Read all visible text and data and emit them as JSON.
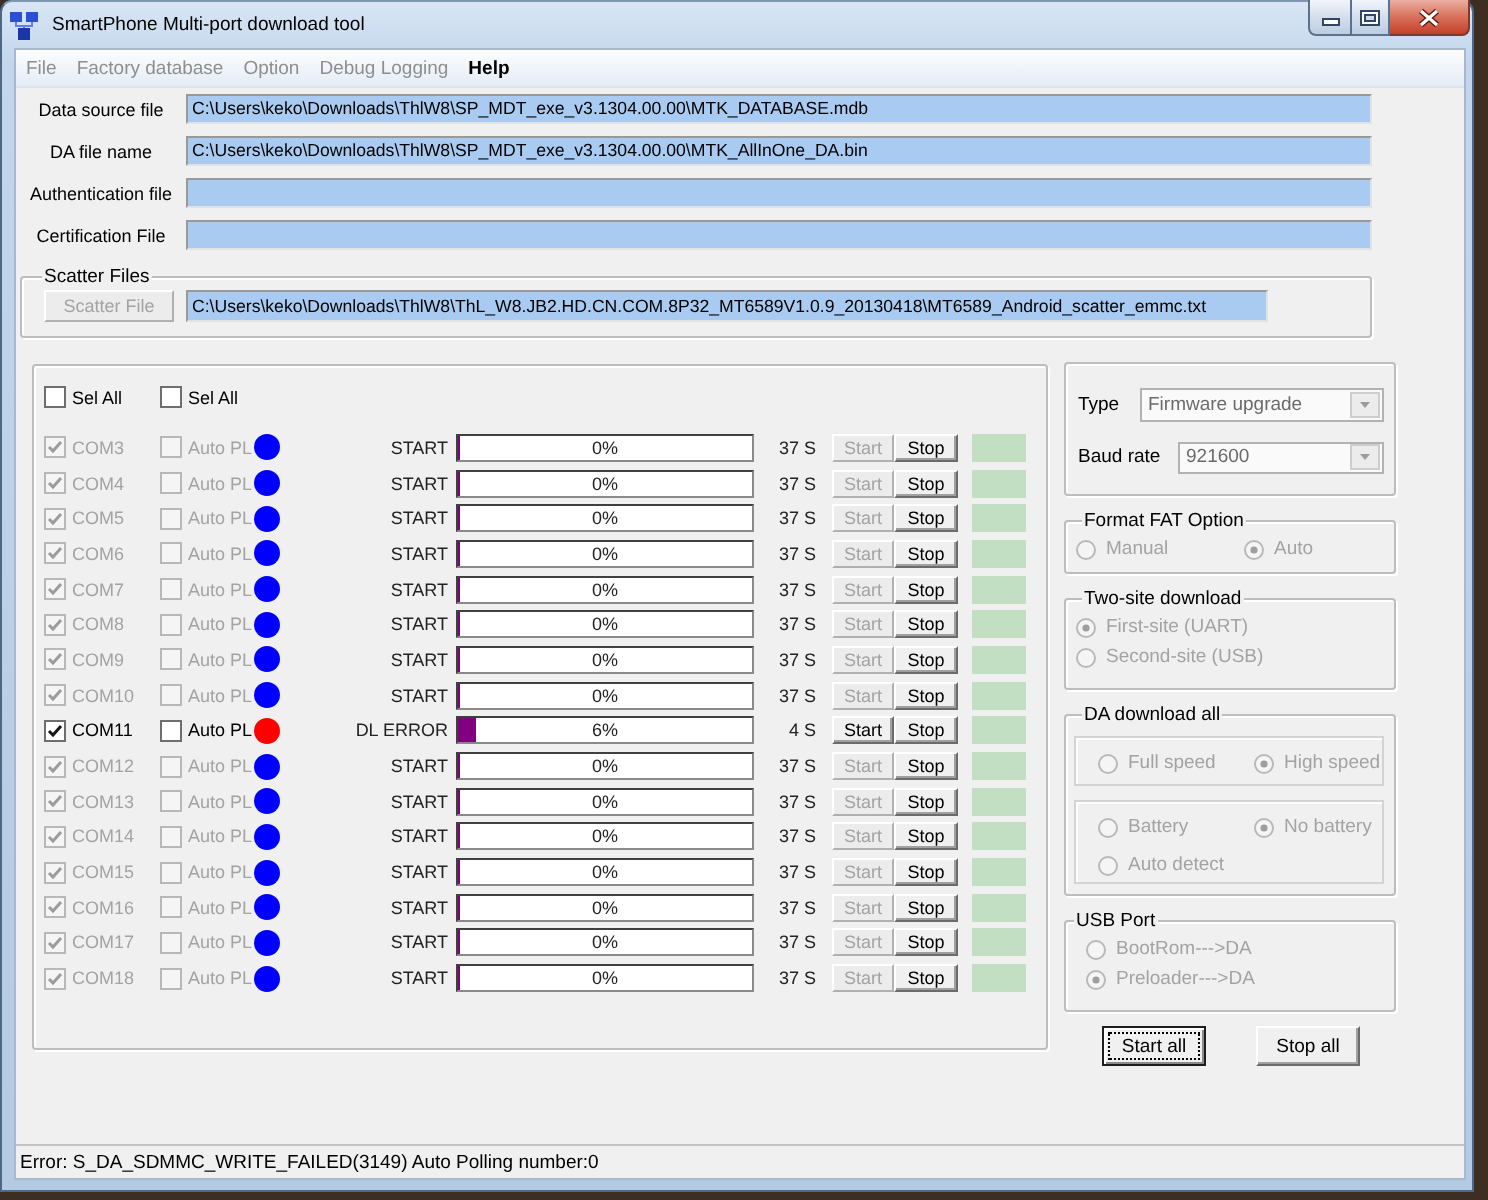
{
  "window": {
    "title": "SmartPhone Multi-port download tool"
  },
  "menu": [
    {
      "label": "File",
      "disabled": true
    },
    {
      "label": "Factory database",
      "disabled": true
    },
    {
      "label": "Option",
      "disabled": true
    },
    {
      "label": "Debug Logging",
      "disabled": true
    },
    {
      "label": "Help",
      "disabled": false
    }
  ],
  "files": [
    {
      "label": "Data source file",
      "value": "C:\\Users\\keko\\Downloads\\ThlW8\\SP_MDT_exe_v3.1304.00.00\\MTK_DATABASE.mdb"
    },
    {
      "label": "DA file name",
      "value": "C:\\Users\\keko\\Downloads\\ThlW8\\SP_MDT_exe_v3.1304.00.00\\MTK_AllInOne_DA.bin"
    },
    {
      "label": "Authentication file"
    },
    {
      "label": "Certification File"
    }
  ],
  "scatter": {
    "title": "Scatter Files",
    "button": {
      "label": "Scatter File",
      "disabled": true
    },
    "value": "C:\\Users\\keko\\Downloads\\ThlW8\\ThL_W8.JB2.HD.CN.COM.8P32_MT6589V1.0.9_20130418\\MT6589_Android_scatter_emmc.txt"
  },
  "select_all": [
    {
      "label": "Sel All",
      "checked": false
    },
    {
      "label": "Sel All",
      "checked": false
    }
  ],
  "ports": [
    {
      "name": "COM3",
      "checked": true,
      "disabled": true,
      "auto_polling": {
        "label": "Auto PL",
        "checked": false
      },
      "color": "#0000ff",
      "status": "START",
      "level": 0,
      "progress": "0%",
      "time": "37 S",
      "start_button": "Start",
      "stop_button": "Stop"
    },
    {
      "name": "COM4",
      "checked": true,
      "disabled": true,
      "auto_polling": {
        "label": "Auto PL",
        "checked": false
      },
      "color": "#0000ff",
      "status": "START",
      "level": 0,
      "progress": "0%",
      "time": "37 S",
      "start_button": "Start",
      "stop_button": "Stop"
    },
    {
      "name": "COM5",
      "checked": true,
      "disabled": true,
      "auto_polling": {
        "label": "Auto PL",
        "checked": false
      },
      "color": "#0000ff",
      "status": "START",
      "level": 0,
      "progress": "0%",
      "time": "37 S",
      "start_button": "Start",
      "stop_button": "Stop"
    },
    {
      "name": "COM6",
      "checked": true,
      "disabled": true,
      "auto_polling": {
        "label": "Auto PL",
        "checked": false
      },
      "color": "#0000ff",
      "status": "START",
      "level": 0,
      "progress": "0%",
      "time": "37 S",
      "start_button": "Start",
      "stop_button": "Stop"
    },
    {
      "name": "COM7",
      "checked": true,
      "disabled": true,
      "auto_polling": {
        "label": "Auto PL",
        "checked": false
      },
      "color": "#0000ff",
      "status": "START",
      "level": 0,
      "progress": "0%",
      "time": "37 S",
      "start_button": "Start",
      "stop_button": "Stop"
    },
    {
      "name": "COM8",
      "checked": true,
      "disabled": true,
      "auto_polling": {
        "label": "Auto PL",
        "checked": false
      },
      "color": "#0000ff",
      "status": "START",
      "level": 0,
      "progress": "0%",
      "time": "37 S",
      "start_button": "Start",
      "stop_button": "Stop"
    },
    {
      "name": "COM9",
      "checked": true,
      "disabled": true,
      "auto_polling": {
        "label": "Auto PL",
        "checked": false
      },
      "color": "#0000ff",
      "status": "START",
      "level": 0,
      "progress": "0%",
      "time": "37 S",
      "start_button": "Start",
      "stop_button": "Stop"
    },
    {
      "name": "COM10",
      "checked": true,
      "disabled": true,
      "auto_polling": {
        "label": "Auto PL",
        "checked": false
      },
      "color": "#0000ff",
      "status": "START",
      "level": 0,
      "progress": "0%",
      "time": "37 S",
      "start_button": "Start",
      "stop_button": "Stop"
    },
    {
      "name": "COM11",
      "checked": true,
      "disabled": false,
      "auto_polling": {
        "label": "Auto PL",
        "checked": false
      },
      "color": "#ff0000",
      "status": "DL ERROR",
      "level": 0.06,
      "progress": "6%",
      "time": "4 S",
      "start_button": "Start",
      "stop_button": "Stop"
    },
    {
      "name": "COM12",
      "checked": true,
      "disabled": true,
      "auto_polling": {
        "label": "Auto PL",
        "checked": false
      },
      "color": "#0000ff",
      "status": "START",
      "level": 0,
      "progress": "0%",
      "time": "37 S",
      "start_button": "Start",
      "stop_button": "Stop"
    },
    {
      "name": "COM13",
      "checked": true,
      "disabled": true,
      "auto_polling": {
        "label": "Auto PL",
        "checked": false
      },
      "color": "#0000ff",
      "status": "START",
      "level": 0,
      "progress": "0%",
      "time": "37 S",
      "start_button": "Start",
      "stop_button": "Stop"
    },
    {
      "name": "COM14",
      "checked": true,
      "disabled": true,
      "auto_polling": {
        "label": "Auto PL",
        "checked": false
      },
      "color": "#0000ff",
      "status": "START",
      "level": 0,
      "progress": "0%",
      "time": "37 S",
      "start_button": "Start",
      "stop_button": "Stop"
    },
    {
      "name": "COM15",
      "checked": true,
      "disabled": true,
      "auto_polling": {
        "label": "Auto PL",
        "checked": false
      },
      "color": "#0000ff",
      "status": "START",
      "level": 0,
      "progress": "0%",
      "time": "37 S",
      "start_button": "Start",
      "stop_button": "Stop"
    },
    {
      "name": "COM16",
      "checked": true,
      "disabled": true,
      "auto_polling": {
        "label": "Auto PL",
        "checked": false
      },
      "color": "#0000ff",
      "status": "START",
      "level": 0,
      "progress": "0%",
      "time": "37 S",
      "start_button": "Start",
      "stop_button": "Stop"
    },
    {
      "name": "COM17",
      "checked": true,
      "disabled": true,
      "auto_polling": {
        "label": "Auto PL",
        "checked": false
      },
      "color": "#0000ff",
      "status": "START",
      "level": 0,
      "progress": "0%",
      "time": "37 S",
      "start_button": "Start",
      "stop_button": "Stop"
    },
    {
      "name": "COM18",
      "checked": true,
      "disabled": true,
      "auto_polling": {
        "label": "Auto PL",
        "checked": false
      },
      "color": "#0000ff",
      "status": "START",
      "level": 0,
      "progress": "0%",
      "time": "37 S",
      "start_button": "Start",
      "stop_button": "Stop"
    }
  ],
  "settings": {
    "disabled": true,
    "type": {
      "label": "Type",
      "value": "Firmware upgrade"
    },
    "baud_rate": {
      "label": "Baud rate",
      "value": "921600"
    }
  },
  "format_fat": {
    "title": "Format FAT Option",
    "disabled": true,
    "options": [
      {
        "label": "Manual",
        "selected": false
      },
      {
        "label": "Auto",
        "selected": true
      }
    ]
  },
  "two_site_download": {
    "title": "Two-site download",
    "disabled": true,
    "options": [
      {
        "label": "First-site (UART)",
        "selected": true
      },
      {
        "label": "Second-site (USB)",
        "selected": false
      }
    ]
  },
  "da_download_all": {
    "title": "DA download all",
    "disabled": true,
    "speed": [
      {
        "label": "Full speed",
        "selected": false
      },
      {
        "label": "High speed",
        "selected": true
      }
    ],
    "battery": [
      {
        "label": "Battery",
        "selected": false
      },
      {
        "label": "No battery",
        "selected": true
      },
      {
        "label": "Auto detect",
        "selected": false
      }
    ]
  },
  "usb_port": {
    "title": "USB Port",
    "disabled": true,
    "options": [
      {
        "label": "BootRom--->DA",
        "selected": false
      },
      {
        "label": "Preloader--->DA",
        "selected": true
      }
    ]
  },
  "buttons": [
    {
      "label": "Start all",
      "default": true
    },
    {
      "label": "Stop all",
      "default": false
    }
  ],
  "status_bar": {
    "text": "Error: S_DA_SDMMC_WRITE_FAILED(3149) Auto Polling number:0"
  }
}
